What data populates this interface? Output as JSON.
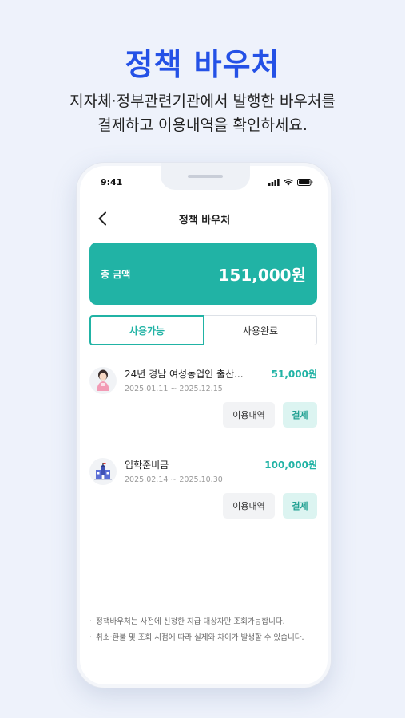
{
  "promo": {
    "title": "정책 바우처",
    "subtitle_line1": "지자체·정부관련기관에서  발행한 바우처를",
    "subtitle_line2": "결제하고 이용내역을 확인하세요."
  },
  "status_bar": {
    "time": "9:41",
    "icons": [
      "signal-icon",
      "wifi-icon",
      "battery-icon"
    ]
  },
  "header": {
    "back_icon": "chevron-left-icon",
    "title": "정책 바우처"
  },
  "total": {
    "label": "총 금액",
    "amount": "151,000원"
  },
  "tabs": [
    {
      "label": "사용가능",
      "active": true
    },
    {
      "label": "사용완료",
      "active": false
    }
  ],
  "vouchers": [
    {
      "icon": "woman-farmer-avatar",
      "name": "24년 경남 여성농업인 출산...",
      "period": "2025.01.11 ~ 2025.12.15",
      "amount": "51,000원",
      "history_label": "이용내역",
      "pay_label": "결제"
    },
    {
      "icon": "school-building-icon",
      "name": "입학준비금",
      "period": "2025.02.14 ~ 2025.10.30",
      "amount": "100,000원",
      "history_label": "이용내역",
      "pay_label": "결제"
    }
  ],
  "notes": [
    "정책바우처는 사전에 신청한 지급 대상자만 조회가능합니다.",
    "취소·환불 및 조회 시점에 따라 실제와 차이가 발생할 수 있습니다."
  ],
  "colors": {
    "accent": "#21b3a5",
    "promo_title": "#2451e6",
    "background": "#eef2fb"
  }
}
